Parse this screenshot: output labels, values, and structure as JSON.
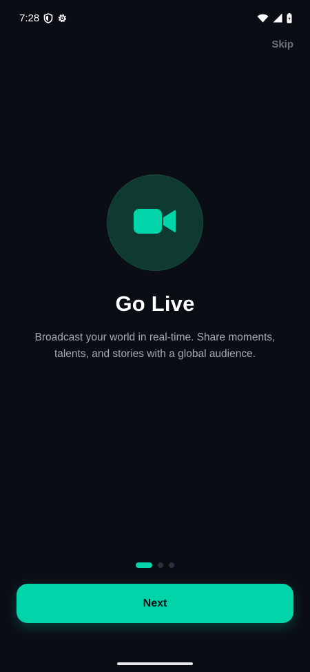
{
  "status_bar": {
    "time": "7:28",
    "left_icons": [
      "shield-icon",
      "gear-icon"
    ],
    "right_icons": [
      "wifi-icon",
      "signal-icon",
      "battery-icon"
    ]
  },
  "header": {
    "skip_label": "Skip"
  },
  "slide": {
    "icon": "video-camera-icon",
    "title": "Go Live",
    "description": "Broadcast your world in real-time. Share moments, talents, and stories with a global audience."
  },
  "pager": {
    "total": 3,
    "current": 1
  },
  "footer": {
    "next_label": "Next"
  },
  "colors": {
    "background": "#0b0d15",
    "accent": "#00d4a9",
    "icon_circle": "#0f3a31",
    "muted_text": "#a7abb8",
    "skip_text": "#6c7080",
    "inactive_dot": "#2c3040"
  }
}
